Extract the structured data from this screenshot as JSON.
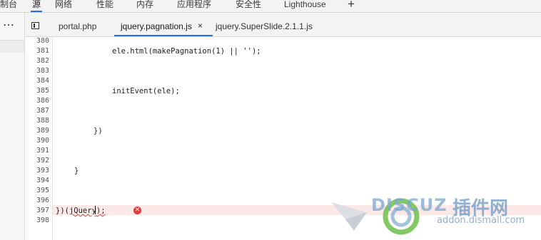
{
  "top_tabs": {
    "console_partial": "控制台",
    "sources": "源",
    "network": "网络",
    "performance": "性能",
    "memory": "内存",
    "application": "应用程序",
    "security": "安全性",
    "lighthouse": "Lighthouse",
    "add": "+"
  },
  "left_panel": {
    "more": "⋯"
  },
  "file_tabs": [
    {
      "label": "portal.php"
    },
    {
      "label": "jquery.pagnation.js",
      "active": true,
      "close": "×"
    },
    {
      "label": "jquery.SuperSlide.2.1.1.js"
    }
  ],
  "editor": {
    "line_numbers": [
      "380",
      "381",
      "382",
      "383",
      "384",
      "385",
      "386",
      "387",
      "388",
      "389",
      "390",
      "391",
      "392",
      "393",
      "394",
      "395",
      "396",
      "397",
      "398"
    ],
    "code": {
      "l381": "ele.html(makePagnation(1) || '');",
      "l385": "initEvent(ele);",
      "l389": "})",
      "l393": "}",
      "l397_a": "})(",
      "l397_b": "jQuery",
      "l397_c": ");"
    },
    "error_line": "397",
    "error_icon": "error-icon"
  },
  "watermark": {
    "text1": "DISCUZ",
    "text2": "插件网",
    "url": "addon.dismall.com"
  }
}
